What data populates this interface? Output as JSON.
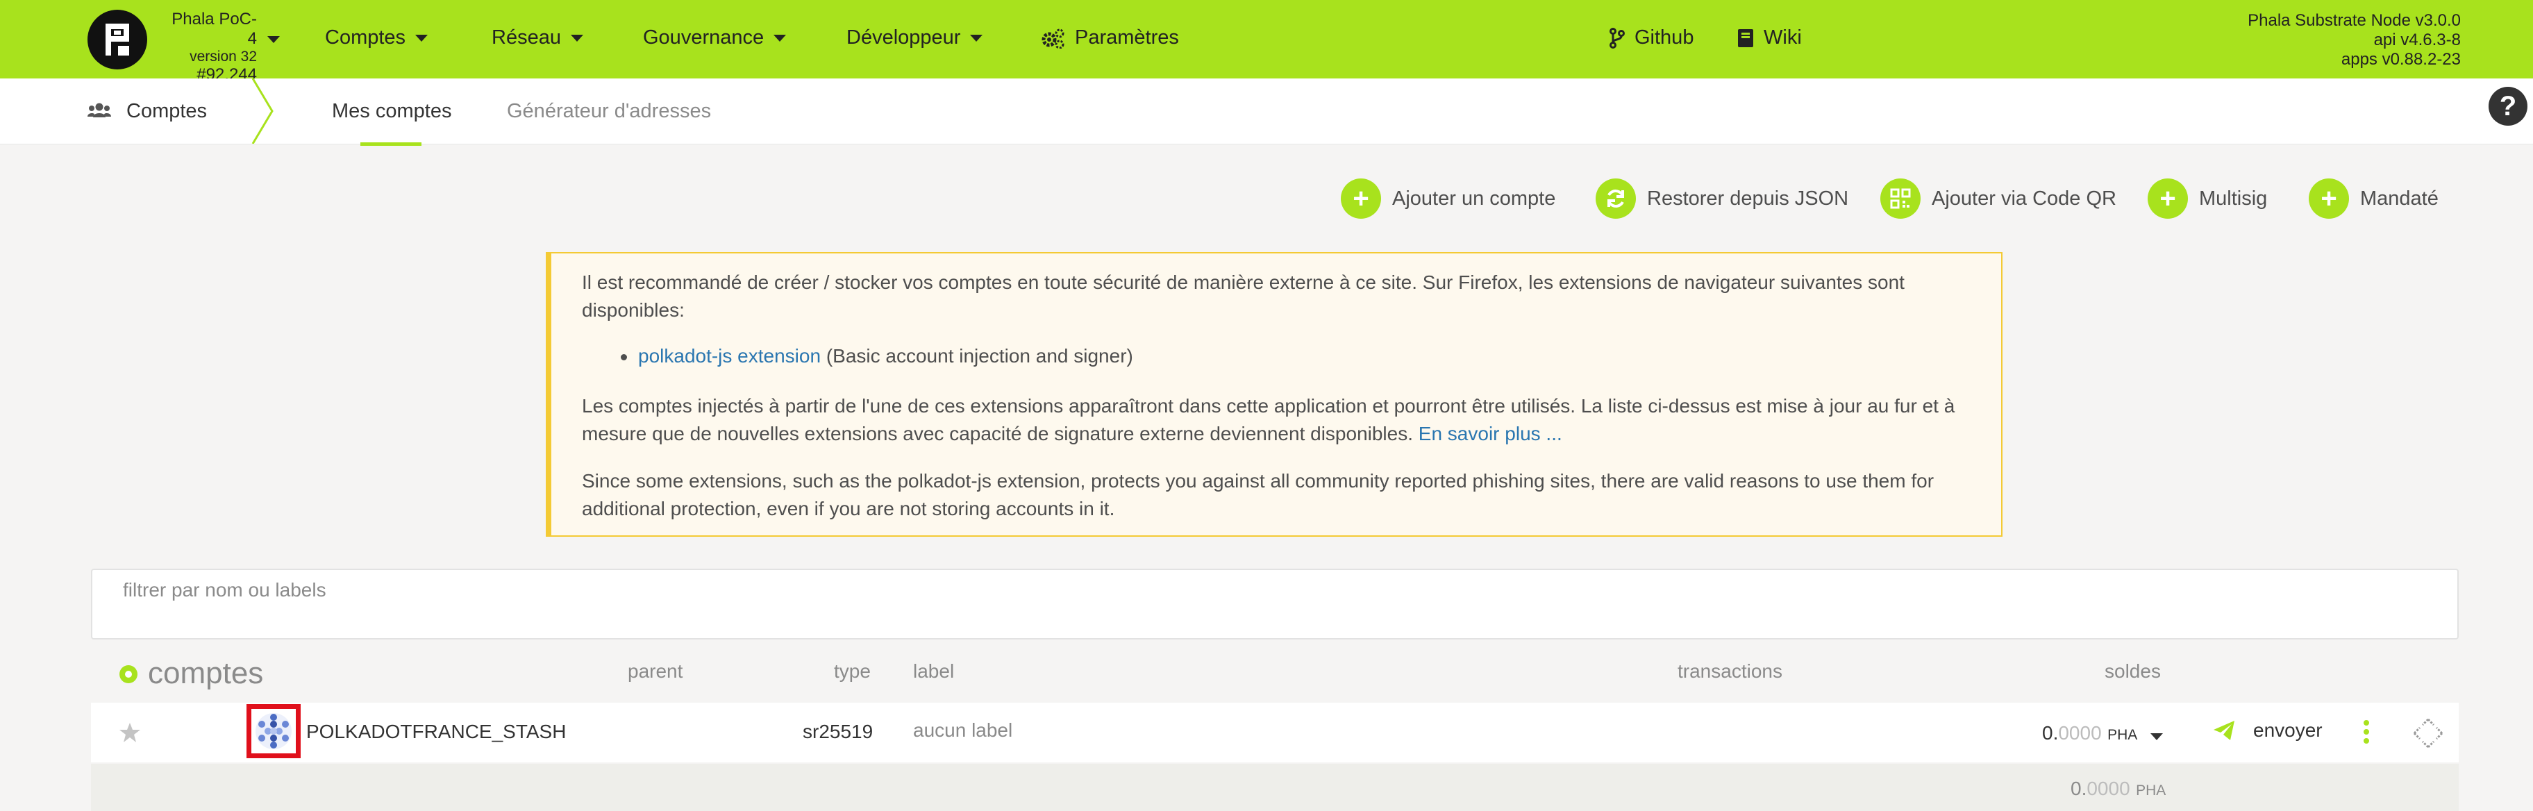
{
  "theme": {
    "accent": "#a8e21d",
    "highlight": "#e0101b"
  },
  "chain": {
    "name": "Phala PoC-4",
    "version": "version 32",
    "block": "#92,244"
  },
  "nav": [
    {
      "label": "Comptes",
      "icon": "caret-down-icon"
    },
    {
      "label": "Réseau",
      "icon": "caret-down-icon"
    },
    {
      "label": "Gouvernance",
      "icon": "caret-down-icon"
    },
    {
      "label": "Développeur",
      "icon": "caret-down-icon"
    },
    {
      "label": "Paramètres",
      "icon": "gears-icon"
    }
  ],
  "links": [
    {
      "label": "Github",
      "icon": "code-branch-icon"
    },
    {
      "label": "Wiki",
      "icon": "book-icon"
    }
  ],
  "node": {
    "name": "Phala Substrate Node v3.0.0",
    "api": "api v4.6.3-8",
    "apps": "apps v0.88.2-23"
  },
  "subnav": {
    "section": "Comptes",
    "tabs": [
      "Mes comptes",
      "Générateur d'adresses"
    ]
  },
  "help": "?",
  "actions": [
    {
      "label": "Ajouter un compte",
      "icon": "plus-icon"
    },
    {
      "label": "Restorer depuis JSON",
      "icon": "sync-icon"
    },
    {
      "label": "Ajouter via Code QR",
      "icon": "qrcode-icon"
    },
    {
      "label": "Multisig",
      "icon": "plus-icon"
    },
    {
      "label": "Mandaté",
      "icon": "plus-icon"
    }
  ],
  "info": {
    "p1": "Il est recommandé de créer / stocker vos comptes en toute sécurité de manière externe à ce site. Sur Firefox, les extensions de navigateur suivantes sont disponibles:",
    "ext_link": "polkadot-js extension",
    "ext_desc": " (Basic account injection and signer)",
    "p2": "Les comptes injectés à partir de l'une de ces extensions apparaîtront dans cette application et pourront être utilisés. La liste ci-dessus est mise à jour au fur et à mesure que de nouvelles extensions avec capacité de signature externe deviennent disponibles.",
    "learn_more": "En savoir plus ...",
    "p3": "Since some extensions, such as the polkadot-js extension, protects you against all community reported phishing sites, there are valid reasons to use them for additional protection, even if you are not storing accounts in it."
  },
  "filter": {
    "placeholder": "filtrer par nom ou labels"
  },
  "table": {
    "title": "comptes",
    "headers": {
      "parent": "parent",
      "type": "type",
      "label": "label",
      "transactions": "transactions",
      "balances": "soldes"
    },
    "rows": [
      {
        "name": "POLKADOTFRANCE_STASH",
        "type": "sr25519",
        "label": "aucun label",
        "balance_int": "0.",
        "balance_dec": "0000",
        "unit": "PHA",
        "send": "envoyer"
      }
    ],
    "total": {
      "int": "0.",
      "dec": "0000",
      "unit": "PHA"
    }
  }
}
